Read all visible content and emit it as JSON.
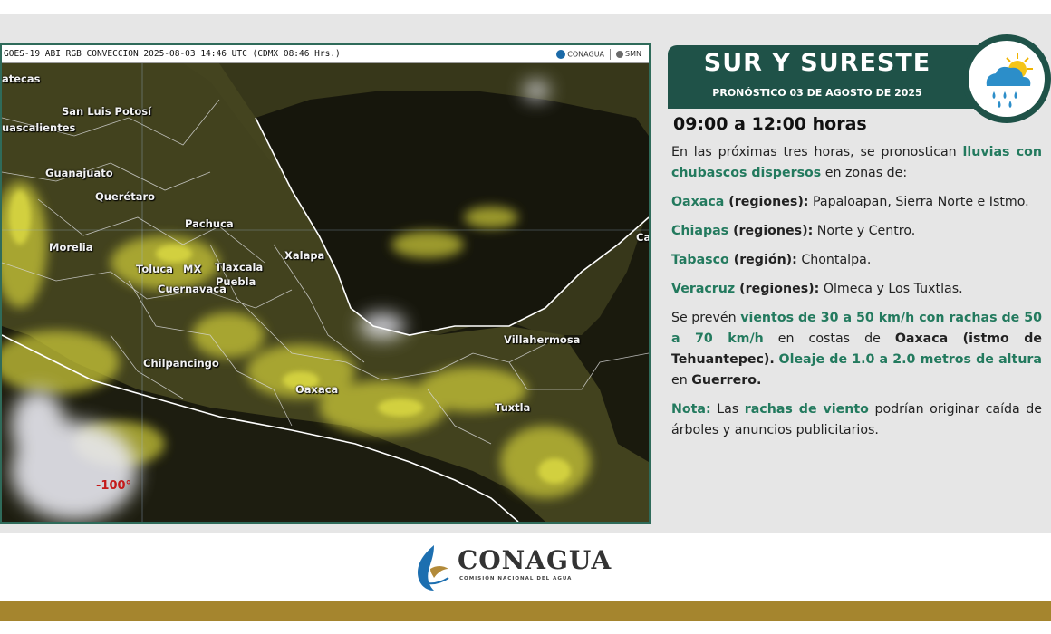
{
  "map": {
    "title": "GOES-19 ABI RGB CONVECCION 2025-08-03 14:46 UTC (CDMX  08:46 Hrs.)",
    "logo1": "CONAGUA",
    "logo2": "SMN",
    "cities": [
      "atecas",
      "San Luis Potosí",
      "uascalientes",
      "Guanajuato",
      "Querétaro",
      "Pachuca",
      "Morelia",
      "Xalapa",
      "Toluca",
      "MX",
      "Tlaxcala",
      "Puebla",
      "Cuernavaca",
      "Villahermosa",
      "Chilpancingo",
      "Oaxaca",
      "Tuxtla",
      "Ca"
    ],
    "longitude_label": "-100°"
  },
  "banner": {
    "title": "SUR Y SURESTE",
    "subtitle": "PRONÓSTICO 03 DE AGOSTO DE 2025"
  },
  "forecast": {
    "time": "09:00 a 12:00 horas",
    "p1": {
      "a": "En las próximas tres horas, se pronostican ",
      "b": "lluvias con chubascos dispersos",
      "c": " en zonas de:"
    },
    "p2": {
      "a": "Oaxaca",
      "b": " (regiones):",
      "c": " Papaloapan, Sierra Norte e Istmo."
    },
    "p3": {
      "a": "Chiapas",
      "b": " (regiones):",
      "c": " Norte y Centro."
    },
    "p4": {
      "a": "Tabasco",
      "b": " (región):",
      "c": " Chontalpa."
    },
    "p5": {
      "a": "Veracruz",
      "b": " (regiones):",
      "c": " Olmeca y Los Tuxtlas."
    },
    "p6": {
      "a": "Se prevén ",
      "b": "vientos de 30 a 50 km/h con rachas de 50 a 70 km/h",
      "c": " en costas de ",
      "d": "Oaxaca (istmo de Tehuantepec).",
      "e": " ",
      "f": "Oleaje de 1.0 a 2.0 metros de altura",
      "g": " en ",
      "h": "Guerrero."
    },
    "p7": {
      "a": "Nota:",
      "b": " Las ",
      "c": "rachas de viento",
      "d": " podrían originar caída de árboles y anuncios publicitarios."
    }
  },
  "footer": {
    "logo": "CONAGUA",
    "logo_sub": "COMISIÓN NACIONAL DEL AGUA"
  },
  "colors": {
    "banner": "#1f5248",
    "accent_green": "#237a5e",
    "gold_bar": "#a5852e"
  },
  "icons": [
    "weather-partly-cloudy-rain-icon",
    "conagua-logo-icon"
  ]
}
